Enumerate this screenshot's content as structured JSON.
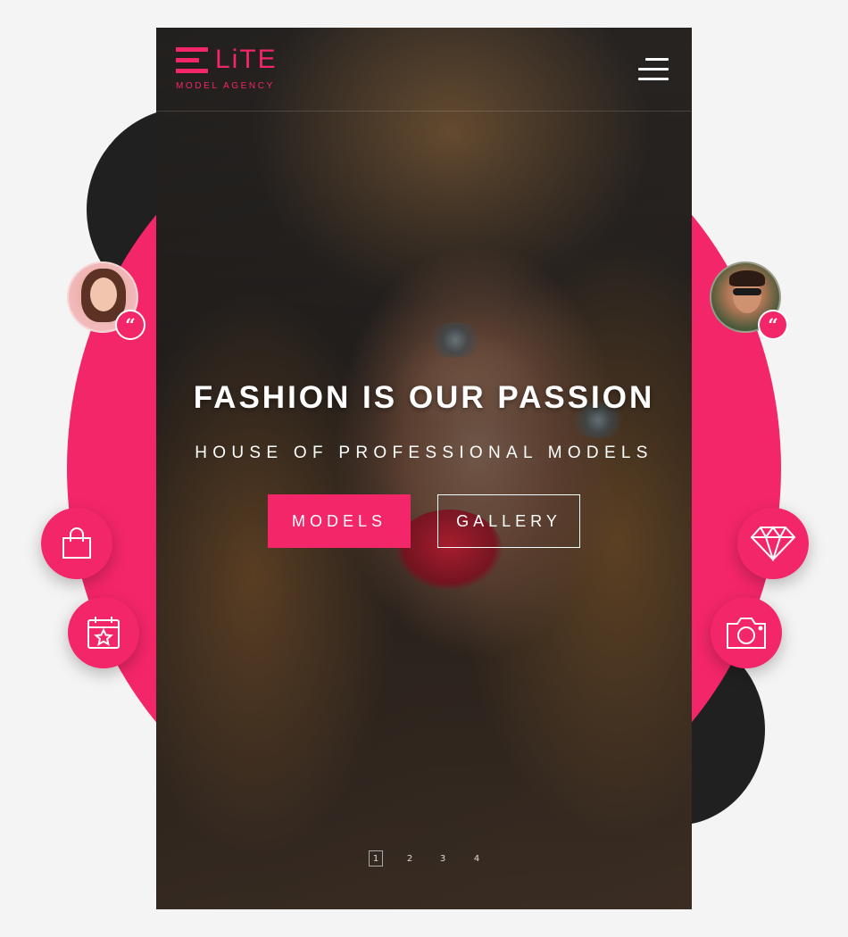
{
  "header": {
    "logo_word": "LiTE",
    "logo_sub": "MODEL AGENCY",
    "menu_icon": "hamburger-menu-icon"
  },
  "hero": {
    "title": "FASHION IS OUR PASSION",
    "subtitle": "HOUSE OF PROFESSIONAL MODELS",
    "buttons": {
      "models": "MODELS",
      "gallery": "GALLERY"
    }
  },
  "pager": {
    "pages": [
      "1",
      "2",
      "3",
      "4"
    ],
    "active": "1"
  },
  "decor": {
    "testimonials": [
      {
        "avatar": "female-avatar",
        "icon": "quote-icon",
        "glyph": "“"
      },
      {
        "avatar": "male-avatar",
        "icon": "quote-icon",
        "glyph": "“"
      }
    ],
    "feature_icons": [
      "shopping-bag-icon",
      "calendar-star-icon",
      "diamond-icon",
      "camera-icon"
    ]
  },
  "colors": {
    "accent": "#f4266a",
    "dark": "#202020",
    "background": "#f4f4f4"
  }
}
